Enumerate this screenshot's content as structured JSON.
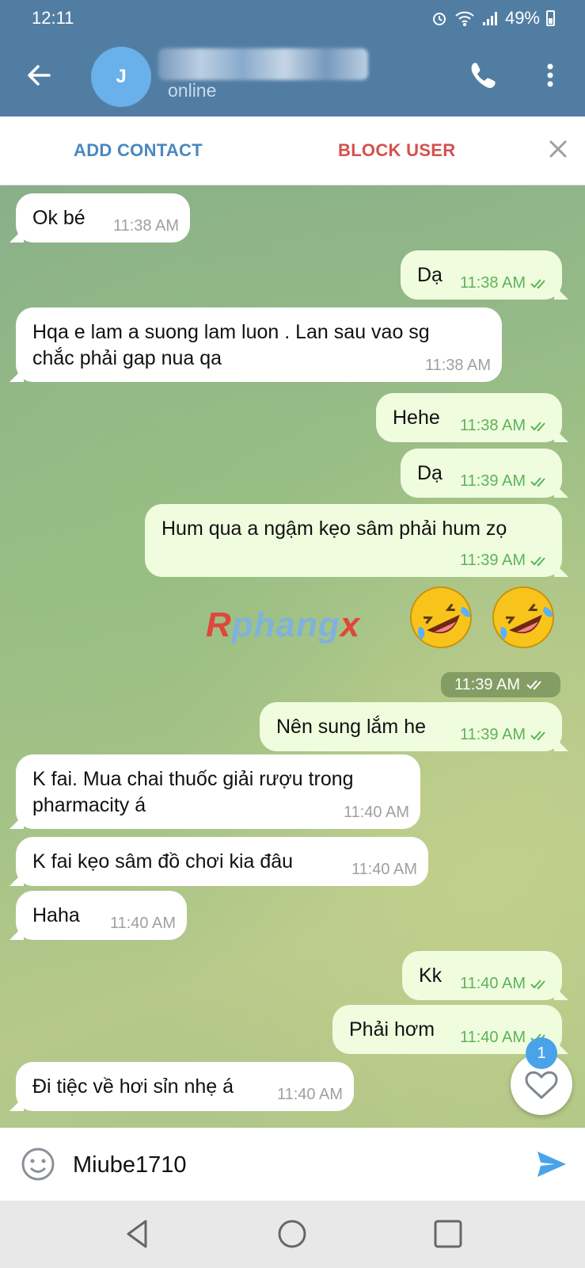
{
  "status_bar": {
    "time": "12:11",
    "battery": "49%"
  },
  "header": {
    "avatar_letter": "J",
    "status": "online"
  },
  "action_bar": {
    "add_contact": "ADD CONTACT",
    "block_user": "BLOCK USER"
  },
  "messages": [
    {
      "dir": "in",
      "text": "Ok bé",
      "time": "11:38 AM"
    },
    {
      "dir": "out",
      "text": "Dạ",
      "time": "11:38 AM"
    },
    {
      "dir": "in",
      "lines": [
        "Hqa e lam a suong lam luon . Lan sau vao sg",
        "chắc phải gap nua qa"
      ],
      "time": "11:38 AM"
    },
    {
      "dir": "out",
      "text": "Hehe",
      "time": "11:38 AM"
    },
    {
      "dir": "out",
      "text": "Dạ",
      "time": "11:39 AM"
    },
    {
      "dir": "out",
      "text": "Hum qua a ngậm kẹo sâm phải hum zọ",
      "time": "11:39 AM"
    },
    {
      "dir": "out",
      "type": "emoji",
      "emoji_names": [
        "rofl-emoji",
        "rofl-emoji"
      ],
      "time": "11:39 AM"
    },
    {
      "dir": "out",
      "text": "Nên sung lắm he",
      "time": "11:39 AM"
    },
    {
      "dir": "in",
      "lines": [
        "K fai. Mua chai thuốc giải rượu trong",
        "pharmacity á"
      ],
      "time": "11:40 AM"
    },
    {
      "dir": "in",
      "text": "K fai kẹo sâm đồ chơi kia đâu",
      "time": "11:40 AM"
    },
    {
      "dir": "in",
      "text": "Haha",
      "time": "11:40 AM"
    },
    {
      "dir": "out",
      "text": "Kk",
      "time": "11:40 AM"
    },
    {
      "dir": "out",
      "text": "Phải hơm",
      "time": "11:40 AM"
    },
    {
      "dir": "in",
      "text": "Đi tiệc về hơi sỉn nhẹ á",
      "time": "11:40 AM"
    }
  ],
  "watermark": {
    "r": "R",
    "mid": "phang",
    "x": "x"
  },
  "reaction_badge": "1",
  "input": {
    "value": "Miube1710"
  },
  "colors": {
    "header": "#527da3",
    "incoming": "#ffffff",
    "outgoing": "#effdde",
    "time_out": "#5eb258",
    "block": "#d64f4f",
    "add": "#4a87bf"
  }
}
